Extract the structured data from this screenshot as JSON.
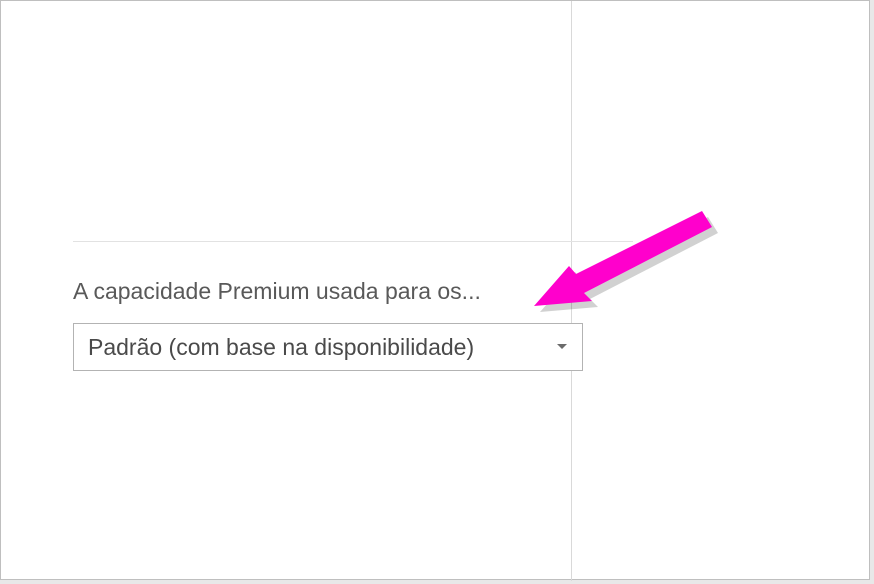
{
  "section": {
    "label": "A capacidade Premium usada para os..."
  },
  "dropdown": {
    "selected": "Padrão (com base na disponibilidade)"
  },
  "colors": {
    "annotation": "#ff00cc"
  }
}
